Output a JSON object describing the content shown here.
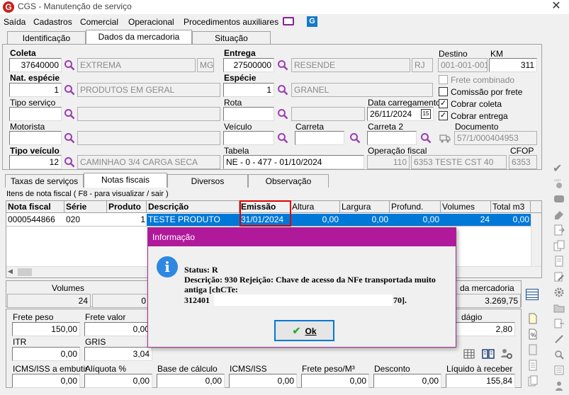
{
  "window": {
    "title": "CGS - Manutenção de serviço"
  },
  "menu": [
    "Saída",
    "Cadastros",
    "Comercial",
    "Operacional",
    "Procedimentos auxiliares"
  ],
  "top_tabs": [
    "Identificação",
    "Dados da mercadoria",
    "Situação"
  ],
  "form": {
    "coleta": {
      "label": "Coleta",
      "code": "37640000",
      "name": "EXTREMA",
      "uf": "MG"
    },
    "entrega": {
      "label": "Entrega",
      "code": "27500000",
      "name": "RESENDE",
      "uf": "RJ"
    },
    "destino": {
      "label": "Destino",
      "value": "001-001-001"
    },
    "km": {
      "label": "KM",
      "value": "311"
    },
    "nat_especie": {
      "label": "Nat. espécie",
      "code": "1",
      "name": "PRODUTOS EM GERAL"
    },
    "especie": {
      "label": "Espécie",
      "code": "1",
      "name": "GRANEL"
    },
    "frete_combinado": "Frete combinado",
    "comissao_frete": "Comissão por frete",
    "cobrar_coleta": "Cobrar coleta",
    "cobrar_entrega": "Cobrar entrega",
    "tipo_servico": {
      "label": "Tipo serviço"
    },
    "rota": {
      "label": "Rota"
    },
    "data_carregamento": {
      "label": "Data carregamento",
      "value": "26/11/2024",
      "cal": "15"
    },
    "motorista": {
      "label": "Motorista"
    },
    "veiculo": {
      "label": "Veículo"
    },
    "carreta": {
      "label": "Carreta"
    },
    "carreta2": {
      "label": "Carreta 2"
    },
    "documento": {
      "label": "Documento",
      "value": "57/1/000404953"
    },
    "tipo_veiculo": {
      "label": "Tipo veículo",
      "code": "12",
      "name": "CAMINHAO 3/4 CARGA SECA"
    },
    "tabela": {
      "label": "Tabela",
      "value": "NE - 0 - 477 - 01/10/2024"
    },
    "operacao_fiscal": {
      "label": "Operação fiscal",
      "code": "110",
      "name": "6353 TESTE CST 40"
    },
    "cfop": {
      "label": "CFOP",
      "value": "6353"
    }
  },
  "sub_tabs": [
    "Taxas de serviços",
    "Notas fiscais",
    "Diversos",
    "Observação"
  ],
  "grid": {
    "caption": "Itens de nota fiscal ( F8 - para visualizar / sair )",
    "columns": [
      "Nota fiscal",
      "Série",
      "Produto",
      "Descrição",
      "Emissão",
      "Altura",
      "Largura",
      "Profund.",
      "Volumes",
      "Total m3"
    ],
    "row": [
      "0000544866",
      "020",
      "1",
      "TESTE PRODUTO",
      "31/01/2024",
      "0,00",
      "0,00",
      "0,00",
      "24",
      "0,00"
    ]
  },
  "totals": {
    "volumes_label": "Volumes",
    "volumes": "24",
    "col2_partial": "0",
    "merc_label": "da mercadoria",
    "merc_value": "3.269,75"
  },
  "fin": {
    "frete_peso": {
      "label": "Frete peso",
      "value": "150,00"
    },
    "frete_valor": {
      "label": "Frete valor",
      "value": "0,00"
    },
    "pedagio": {
      "label": "dágio",
      "value": "2,80"
    },
    "itr": {
      "label": "ITR",
      "value": "0,00"
    },
    "gris": {
      "label": "GRIS",
      "value": "3,04"
    },
    "icms_emb": {
      "label": "ICMS/ISS a embutir",
      "value": "0,00"
    },
    "aliquota": {
      "label": "Alíquota %",
      "value": "0,00"
    },
    "base": {
      "label": "Base de cálculo",
      "value": "0,00"
    },
    "icms": {
      "label": "ICMS/ISS",
      "value": "0,00"
    },
    "frete_m3": {
      "label": "Frete peso/M³",
      "value": "0,00"
    },
    "desconto": {
      "label": "Desconto",
      "value": "0,00"
    },
    "liquido": {
      "label": "Líquido à receber",
      "value": "155,84"
    }
  },
  "dialog": {
    "title": "Informação",
    "status": "Status: R",
    "descricao": "Descrição: 930 Rejeição: Chave de acesso da NFe transportada muito antiga [chCTe:",
    "key_start": "312401",
    "key_end": "70].",
    "ok": "Ok"
  },
  "colors": {
    "accent": "#b0199a",
    "selection": "#0078d7",
    "highlight_box": "#e00000"
  }
}
